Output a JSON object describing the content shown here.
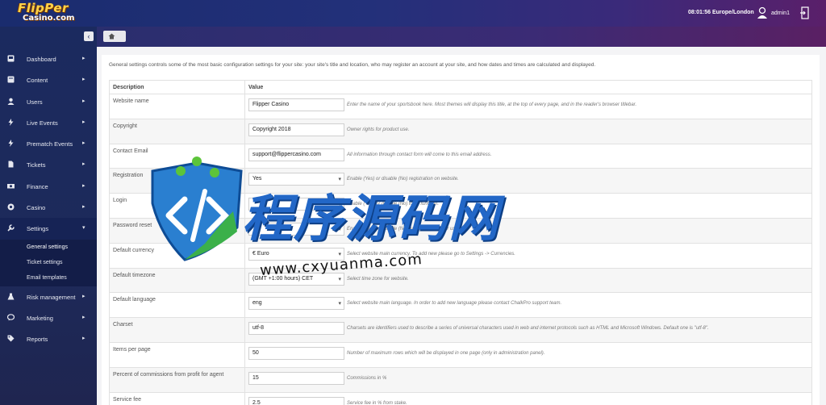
{
  "header": {
    "logo_line1": "FlipPer",
    "logo_line2": "Casino.com",
    "clock": "08:01:56 Europe/London",
    "username": "admin1"
  },
  "sidebar": {
    "items": [
      {
        "label": "Dashboard",
        "icon": "dashboard-icon"
      },
      {
        "label": "Content",
        "icon": "book-icon"
      },
      {
        "label": "Users",
        "icon": "user-icon"
      },
      {
        "label": "Live Events",
        "icon": "bolt-icon"
      },
      {
        "label": "Prematch Events",
        "icon": "bolt-icon"
      },
      {
        "label": "Tickets",
        "icon": "file-icon"
      },
      {
        "label": "Finance",
        "icon": "money-icon"
      },
      {
        "label": "Casino",
        "icon": "target-icon"
      },
      {
        "label": "Settings",
        "icon": "wrench-icon"
      }
    ],
    "settings_sub": [
      "General settings",
      "Ticket settings",
      "Email templates"
    ],
    "items_after": [
      {
        "label": "Risk management",
        "icon": "flask-icon"
      },
      {
        "label": "Marketing",
        "icon": "chat-icon"
      },
      {
        "label": "Reports",
        "icon": "tag-icon"
      }
    ]
  },
  "main": {
    "intro": "General settings controls some of the most basic configuration settings for your site: your site's title and location, who may register an account at your site, and how dates and times are calculated and displayed.",
    "col_description": "Description",
    "col_value": "Value",
    "rows": [
      {
        "label": "Website name",
        "value": "Flipper Casino",
        "hint": "Enter the name of your sportsbook here. Most themes will display this title, at the top of every page, and in the reader's browser titlebar."
      },
      {
        "label": "Copyright",
        "value": "Copyright 2018",
        "hint": "Owner rights for product use."
      },
      {
        "label": "Contact Email",
        "value": "support@flippercasino.com",
        "hint": "All information through contact form will come to this email address."
      },
      {
        "label": "Registration",
        "value": "Yes",
        "hint": "Enable (Yes) or disable (No) registration on website."
      },
      {
        "label": "Login",
        "value": "",
        "hint": "Enable (Yes) or disable (No) login function."
      },
      {
        "label": "Password reset",
        "value": "",
        "hint": "Enable (Yes) or disable (No) password reset for users."
      },
      {
        "label": "Default currency",
        "value": "€ Euro",
        "hint": "Select website main currency. To add new please go to Settings -> Currencies."
      },
      {
        "label": "Default timezone",
        "value": "(GMT +1:00 hours) CET",
        "hint": "Select time zone for website."
      },
      {
        "label": "Default language",
        "value": "eng",
        "hint": "Select website main language. In order to add new language please contact ChalkPro support team."
      },
      {
        "label": "Charset",
        "value": "utf-8",
        "hint": "Charsets are identifiers used to describe a series of universal characters used in web and internet protocols such as HTML and Microsoft Windows. Default one is \"utf-8\"."
      },
      {
        "label": "Items per page",
        "value": "50",
        "hint": "Number of maximum rows which will be displayed in one page (only in administration panel)."
      },
      {
        "label": "Percent of commissions from profit for agent",
        "value": "15",
        "hint": "Commissions in %"
      },
      {
        "label": "Service fee",
        "value": "2.5",
        "hint": "Service fee in % from stake."
      }
    ]
  },
  "watermark": {
    "text": "程序源码网",
    "url": "www.cxyuanma.com"
  },
  "colors": {
    "header": "#1a2c6e",
    "sidebar": "#1b2a5f",
    "accent": "#2267c7"
  }
}
